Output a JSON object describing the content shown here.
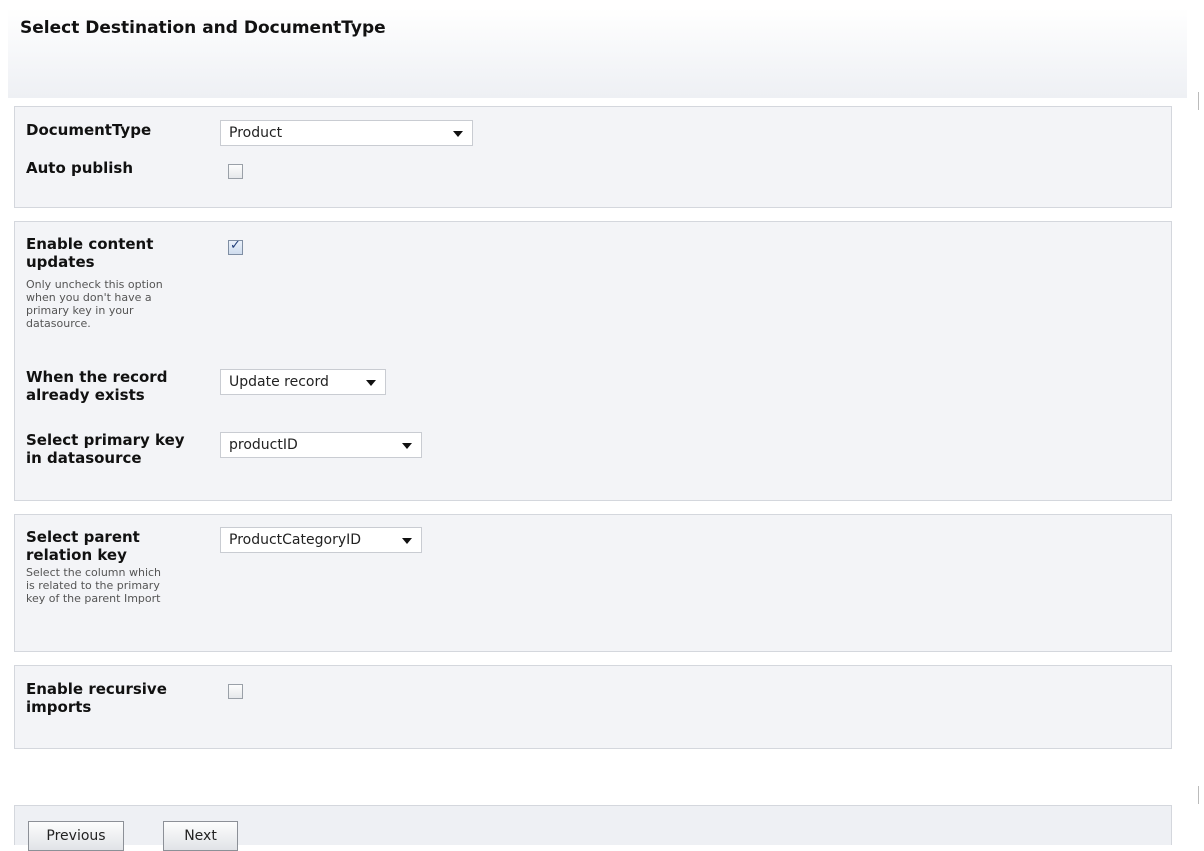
{
  "header": {
    "title": "Select Destination and DocumentType"
  },
  "document_section": {
    "document_type_label": "DocumentType",
    "document_type_value": "Product",
    "auto_publish_label": "Auto publish",
    "auto_publish_checked": false
  },
  "content_updates_section": {
    "enable_label_line1": "Enable content",
    "enable_label_line2": "updates",
    "enable_checked": true,
    "enable_help": [
      "Only uncheck this option",
      "when you don't have a",
      "primary key in your",
      "datasource."
    ],
    "record_exists_label_line1": "When the record",
    "record_exists_label_line2": "already exists",
    "record_exists_value": "Update record",
    "primary_key_label_line1": "Select primary key",
    "primary_key_label_line2": "in datasource",
    "primary_key_value": "productID"
  },
  "parent_relation_section": {
    "label_line1": "Select parent",
    "label_line2": "relation key",
    "help": [
      "Select the column which",
      "is related to the primary",
      "key of the parent Import"
    ],
    "value": "ProductCategoryID"
  },
  "recursive_section": {
    "label_line1": "Enable recursive",
    "label_line2": "imports",
    "checked": false
  },
  "buttons": {
    "previous": "Previous",
    "next": "Next"
  },
  "colors": {
    "panel_bg": "#f3f4f7",
    "panel_border": "#d4d7dd",
    "check_mark": "#23407a"
  },
  "icons": {
    "checkbox_checked": "check-icon",
    "dropdown": "chevron-down-icon"
  }
}
